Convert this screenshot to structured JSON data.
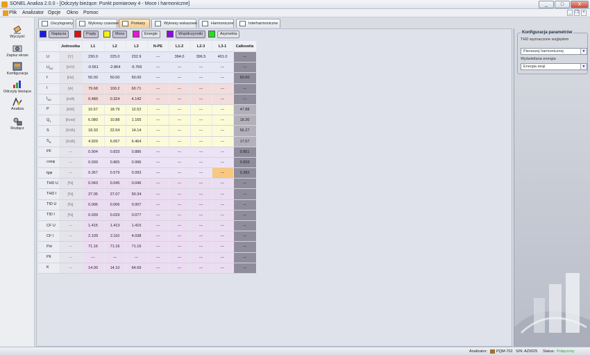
{
  "window": {
    "title": "SONEL Analiza 2.0.0 - [Odczyty bieżące: Punkt pomiarowy 4 - Moce i harmoniczne]",
    "minimize": "_",
    "maximize": "□",
    "close": "X"
  },
  "menu": {
    "items": [
      "Plik",
      "Analizator",
      "Opcje",
      "Okno",
      "Pomoc"
    ],
    "mdi_minimize": "_",
    "mdi_restore": "❐",
    "mdi_close": "×"
  },
  "sidebar": {
    "items": [
      {
        "label": "Wyczyść",
        "icon": "eraser-icon"
      },
      {
        "label": "Zapisz ekran",
        "icon": "camera-icon"
      },
      {
        "label": "Konfiguracja",
        "icon": "config-icon"
      },
      {
        "label": "Odczyty bieżące",
        "icon": "bar-chart-icon"
      },
      {
        "label": "Analiza",
        "icon": "analysis-icon"
      },
      {
        "label": "Rozłącz",
        "icon": "disconnect-icon"
      }
    ]
  },
  "tabs": [
    "Oscylogramy",
    "Wykresy czasowe",
    "Pomiary",
    "Wykresy wskazowe",
    "Harmoniczne",
    "Interharmoniczne"
  ],
  "active_tab": "Pomiary",
  "legend": [
    {
      "label": "Napięcia",
      "color": "#1a1ae6",
      "selected": true
    },
    {
      "label": "Prądy",
      "color": "#e01010",
      "selected": true
    },
    {
      "label": "Moce",
      "color": "#f2f20e",
      "selected": true
    },
    {
      "label": "Energie",
      "color": "#e21ad6",
      "selected": false
    },
    {
      "label": "Współczynniki",
      "color": "#8a10d8",
      "selected": true
    },
    {
      "label": "Asymetria",
      "color": "#20e020",
      "selected": false
    }
  ],
  "table": {
    "headers": [
      "",
      "Jednostka",
      "L1",
      "L2",
      "L3",
      "N-PE",
      "L1-2",
      "L2-3",
      "L3-1",
      "Całkowita"
    ],
    "rows": [
      {
        "name": "U",
        "sub": "",
        "unit": "[V]",
        "values": [
          "230.0",
          "225.0",
          "232.9",
          "---",
          "394.0",
          "396.5",
          "401.0",
          "---"
        ]
      },
      {
        "name": "U",
        "sub": "DC",
        "unit": "[mV]",
        "values": [
          "-0.561",
          "-2.864",
          "-5.769",
          "---",
          "---",
          "---",
          "---",
          "---"
        ]
      },
      {
        "name": "f",
        "sub": "",
        "unit": "[Hz]",
        "values": [
          "50.00",
          "50.00",
          "50.00",
          "---",
          "---",
          "---",
          "---",
          "50.00"
        ]
      },
      {
        "name": "I",
        "sub": "",
        "unit": "[A]",
        "values": [
          "79.68",
          "100.2",
          "60.71",
          "---",
          "---",
          "---",
          "---",
          "---"
        ]
      },
      {
        "name": "I",
        "sub": "DC",
        "unit": "[mA]",
        "values": [
          "0.489",
          "0.324",
          "4.142",
          "---",
          "---",
          "---",
          "---",
          "---"
        ]
      },
      {
        "name": "P",
        "sub": "",
        "unit": "[kW]",
        "values": [
          "16.57",
          "18.79",
          "12.52",
          "---",
          "---",
          "---",
          "---",
          "47.88"
        ]
      },
      {
        "name": "Q",
        "sub": "1",
        "unit": "[kvar]",
        "values": [
          "6.080",
          "10.88",
          "1.165",
          "---",
          "---",
          "---",
          "---",
          "18.30"
        ]
      },
      {
        "name": "S",
        "sub": "",
        "unit": "[kVA]",
        "values": [
          "18.33",
          "22.54",
          "14.14",
          "---",
          "---",
          "---",
          "---",
          "56.27"
        ]
      },
      {
        "name": "S",
        "sub": "N",
        "unit": "[kVA]",
        "values": [
          "4.929",
          "6.067",
          "6.464",
          "---",
          "---",
          "---",
          "---",
          "17.57"
        ]
      },
      {
        "name": "PF",
        "sub": "",
        "unit": "---",
        "values": [
          "0.904",
          "0.833",
          "0.886",
          "---",
          "---",
          "---",
          "---",
          "0.851"
        ]
      },
      {
        "name": "cosφ",
        "sub": "",
        "unit": "---",
        "values": [
          "0.939",
          "0.865",
          "0.996",
          "---",
          "---",
          "---",
          "---",
          "0.833"
        ]
      },
      {
        "name": "tgφ",
        "sub": "",
        "unit": "---",
        "values": [
          "0.367",
          "0.579",
          "0.093",
          "---",
          "---",
          "---",
          "---",
          "0.382"
        ]
      },
      {
        "name": "THD U",
        "sub": "",
        "unit": "[%]",
        "values": [
          "0.043",
          "0.045",
          "0.046",
          "---",
          "---",
          "---",
          "---",
          "---"
        ]
      },
      {
        "name": "THD I",
        "sub": "",
        "unit": "[%]",
        "values": [
          "27.05",
          "27.07",
          "50.34",
          "---",
          "---",
          "---",
          "---",
          "---"
        ]
      },
      {
        "name": "TID U",
        "sub": "",
        "unit": "[%]",
        "values": [
          "0.006",
          "0.006",
          "0.007",
          "---",
          "---",
          "---",
          "---",
          "---"
        ]
      },
      {
        "name": "TID I",
        "sub": "",
        "unit": "[%]",
        "values": [
          "0.039",
          "0.029",
          "0.077",
          "---",
          "---",
          "---",
          "---",
          "---"
        ]
      },
      {
        "name": "CF U",
        "sub": "",
        "unit": "---",
        "values": [
          "1.415",
          "1.413",
          "1.415",
          "---",
          "---",
          "---",
          "---",
          "---"
        ]
      },
      {
        "name": "CF I",
        "sub": "",
        "unit": "---",
        "values": [
          "2.109",
          "2.110",
          "4.038",
          "---",
          "---",
          "---",
          "---",
          "---"
        ]
      },
      {
        "name": "Pst",
        "sub": "",
        "unit": "---",
        "values": [
          "71.16",
          "71.16",
          "71.16",
          "---",
          "---",
          "---",
          "---",
          "---"
        ]
      },
      {
        "name": "Plt",
        "sub": "",
        "unit": "---",
        "values": [
          "---",
          "---",
          "---",
          "---",
          "---",
          "---",
          "---",
          "---"
        ]
      },
      {
        "name": "K",
        "sub": "",
        "unit": "---",
        "values": [
          "14.00",
          "14.10",
          "64.69",
          "---",
          "---",
          "---",
          "---",
          "---"
        ]
      }
    ]
  },
  "right_panel": {
    "title": "Konfiguracja parametrów",
    "thd_label": "THD wyznaczone względem",
    "thd_value": "Pierwszej harmonicznej",
    "energy_label": "Wyświetlana energia",
    "energy_value": "Energia sesji",
    "arrow": "▼"
  },
  "status": {
    "analyzer_label": "Analizator:",
    "analyzer_value": "PQM-702",
    "sn_label": "S/N:",
    "sn_value": "AZ0025",
    "status_label": "Status:",
    "status_value": "Połączony",
    "status_color": "#2ea82e"
  }
}
